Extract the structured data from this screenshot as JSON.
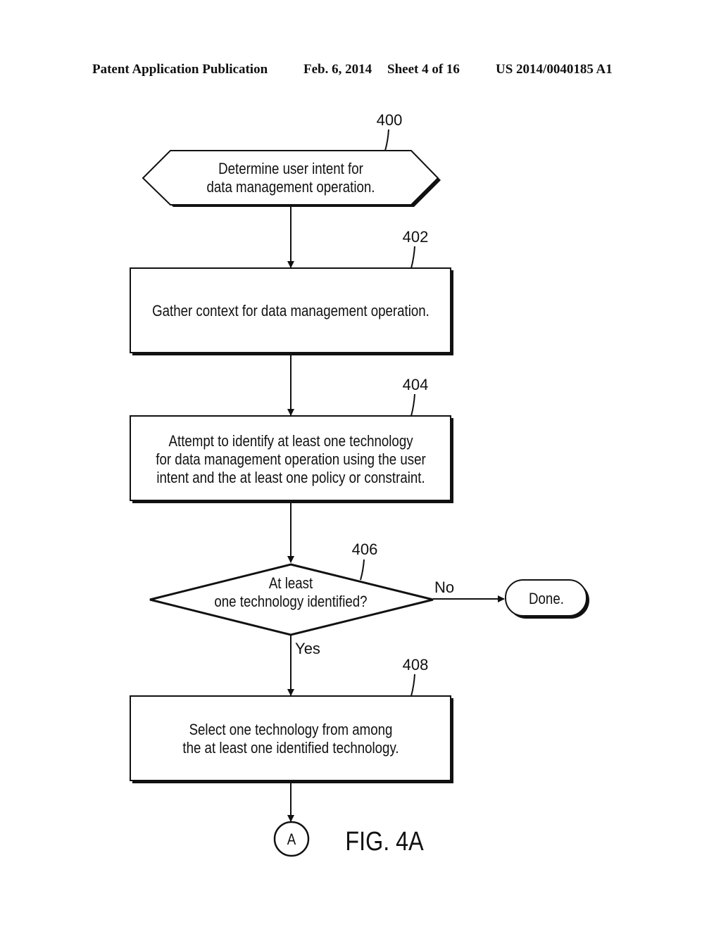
{
  "header": {
    "publication": "Patent Application Publication",
    "date": "Feb. 6, 2014",
    "sheet": "Sheet 4 of 16",
    "patent_number": "US 2014/0040185 A1"
  },
  "figure": {
    "label": "FIG. 4A",
    "nodes": {
      "n400": {
        "ref": "400",
        "type": "preparation",
        "lines": [
          "Determine user intent for",
          "data management operation."
        ]
      },
      "n402": {
        "ref": "402",
        "type": "process",
        "lines": [
          "Gather context for data management operation."
        ]
      },
      "n404": {
        "ref": "404",
        "type": "process",
        "lines": [
          "Attempt to identify at least one technology",
          "for data management operation using the user",
          "intent and the at least one policy or constraint."
        ]
      },
      "n406": {
        "ref": "406",
        "type": "decision",
        "lines": [
          "At least",
          "one technology identified?"
        ]
      },
      "done": {
        "type": "terminator",
        "lines": [
          "Done."
        ]
      },
      "n408": {
        "ref": "408",
        "type": "process",
        "lines": [
          "Select one technology from among",
          "the at least one identified technology."
        ]
      },
      "connector": {
        "type": "connector",
        "label": "A"
      }
    },
    "edges": {
      "no_label": "No",
      "yes_label": "Yes"
    }
  }
}
